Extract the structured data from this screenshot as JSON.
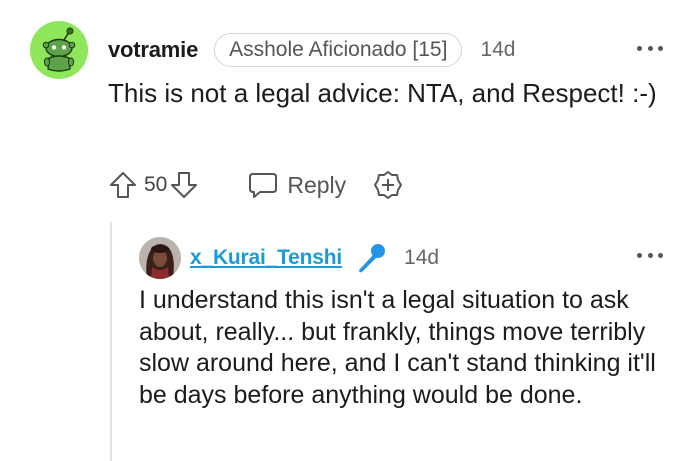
{
  "comment": {
    "username": "votramie",
    "flair": "Asshole Aficionado [15]",
    "timestamp": "14d",
    "body": "This is not a legal advice: NTA, and Respect! :-)",
    "vote_count": "50",
    "reply_label": "Reply",
    "colors": {
      "avatar_bg": "#8ee65a",
      "text": "#1c1c1c",
      "muted": "#666666"
    },
    "icons": [
      "reddit-snoo-avatar",
      "more-icon",
      "upvote-icon",
      "downvote-icon",
      "comment-icon",
      "award-icon"
    ]
  },
  "reply": {
    "username": "x_Kurai_Tenshi",
    "timestamp": "14d",
    "body": "I understand this isn't a legal situation to ask about, really... but frankly, things move terribly slow around here, and I can't stand thinking it'll be days before anything would be done.",
    "colors": {
      "username": "#1c9bd9",
      "mic": "#2196e6"
    },
    "icons": [
      "user-avatar",
      "microphone-icon",
      "more-icon"
    ]
  }
}
